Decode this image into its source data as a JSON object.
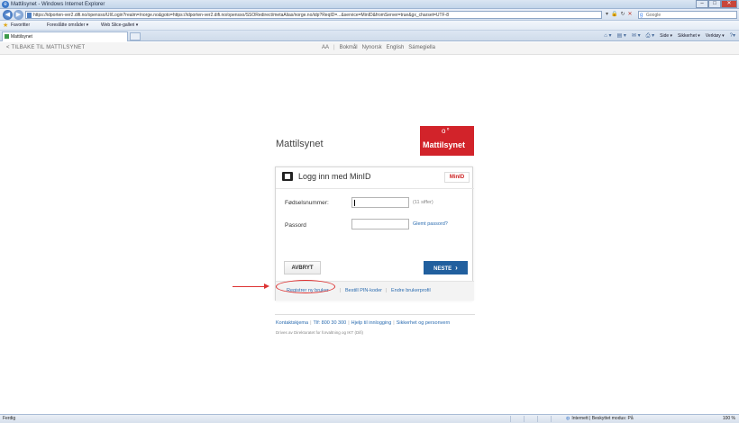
{
  "browser": {
    "title": "Mattilsynet - Windows Internet Explorer",
    "url": "https://idporten-ver2.difi.no/opensso/UI/Login?realm=/norge.no&goto=https://idporten-ver2.difi.no/opensso/SSORedirect/metaAlias/norge.no/idp?ReqID=...&service=MinID&fromServer=true&gx_charset=UTF-8",
    "search_placeholder": "Google",
    "favorites_label": "Favoritter",
    "fav_items": [
      "Foreslåtte områder ▾",
      "Web Slice-galleri ▾"
    ],
    "tab_label": "Mattilsynet",
    "cmd_items": [
      "Side ▾",
      "Sikkerhet ▾",
      "Verktøy ▾"
    ]
  },
  "site": {
    "back_link": "< TILBAKE TIL MATTILSYNET",
    "text_size": "AA",
    "languages": [
      "Bokmål",
      "Nynorsk",
      "English",
      "Sámegiella"
    ],
    "brand": "Mattilsynet",
    "logo_text": "Mattilsynet"
  },
  "login": {
    "heading": "Logg inn med MinID",
    "badge": "MinID",
    "birth_label": "Fødselsnummer:",
    "birth_hint": "(11 siffer)",
    "password_label": "Passord",
    "forgot_link": "Glemt passord?",
    "cancel_label": "AVBRYT",
    "next_label": "NESTE",
    "footer_links": [
      "Registrer ny bruker",
      "Bestill PIN-koder",
      "Endre brukerprofil"
    ]
  },
  "footer": {
    "links": [
      "Kontaktskjema",
      "Tlf: 800 30 300",
      "Hjelp til innlogging",
      "Sikkerhet og personvern"
    ],
    "note": "Drives av Direktoratet for forvaltning og IKT (Difi)"
  },
  "status": {
    "left": "Ferdig",
    "zone": "Internett | Beskyttet modus: På",
    "zoom": "100 %"
  },
  "colors": {
    "brand_red": "#d2232a",
    "next_button": "#215f9e",
    "link": "#2b6cb0",
    "annotation": "#dd3333"
  }
}
